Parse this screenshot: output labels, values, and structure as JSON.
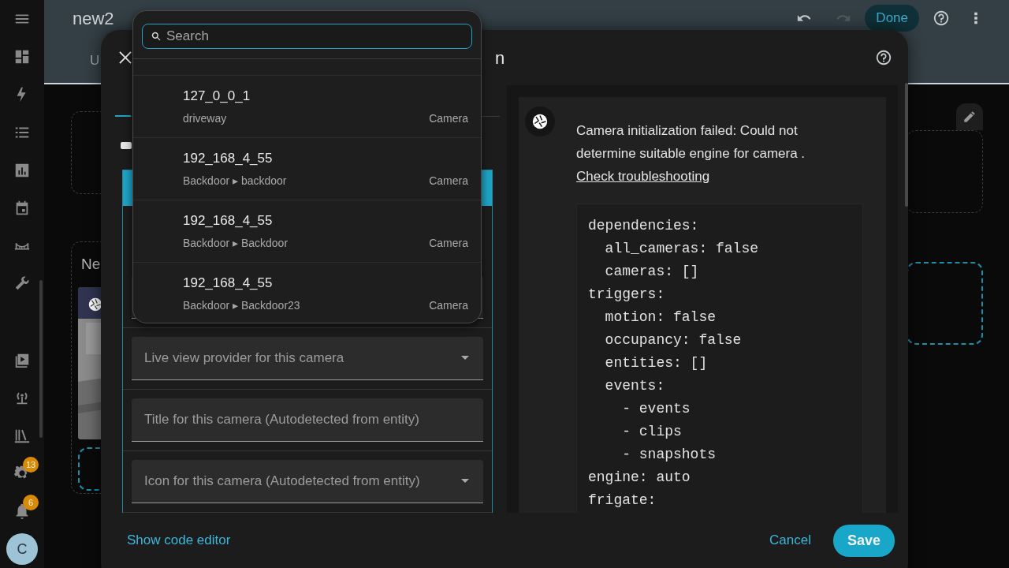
{
  "sidebar": {
    "settings_badge": "13",
    "notifications_badge": "6",
    "avatar": "C"
  },
  "header": {
    "title": "new2",
    "tab": "U",
    "done_button": "Done"
  },
  "dashboard": {
    "card_title": "Ne"
  },
  "dialog": {
    "title": "n",
    "fields": [
      {
        "kind": "select",
        "placeholder": "Live view provider for this camera"
      },
      {
        "kind": "text",
        "placeholder": "Title for this camera (Autodetected from entity)"
      },
      {
        "kind": "select",
        "placeholder": "Icon for this camera (Autodetected from entity)"
      }
    ],
    "message": "Camera initialization failed: Could not determine suitable engine for camera .",
    "link": "Check troubleshooting",
    "code_lines": [
      "dependencies:",
      "  all_cameras: false",
      "  cameras: []",
      "triggers:",
      "  motion: false",
      "  occupancy: false",
      "  entities: []",
      "  events:",
      "    - events",
      "    - clips",
      "    - snapshots",
      "engine: auto",
      "frigate:"
    ],
    "code_editor_link": "Show code editor",
    "cancel_button": "Cancel",
    "save_button": "Save"
  },
  "dropdown": {
    "search_placeholder": "Search",
    "items": [
      {
        "name": "127_0_0_1",
        "path": "driveway",
        "type": "Camera"
      },
      {
        "name": "192_168_4_55",
        "path": "Backdoor ▸ backdoor",
        "type": "Camera"
      },
      {
        "name": "192_168_4_55",
        "path": "Backdoor ▸ Backdoor",
        "type": "Camera"
      },
      {
        "name": "192_168_4_55",
        "path": "Backdoor ▸ Backdoor23",
        "type": "Camera"
      }
    ]
  }
}
